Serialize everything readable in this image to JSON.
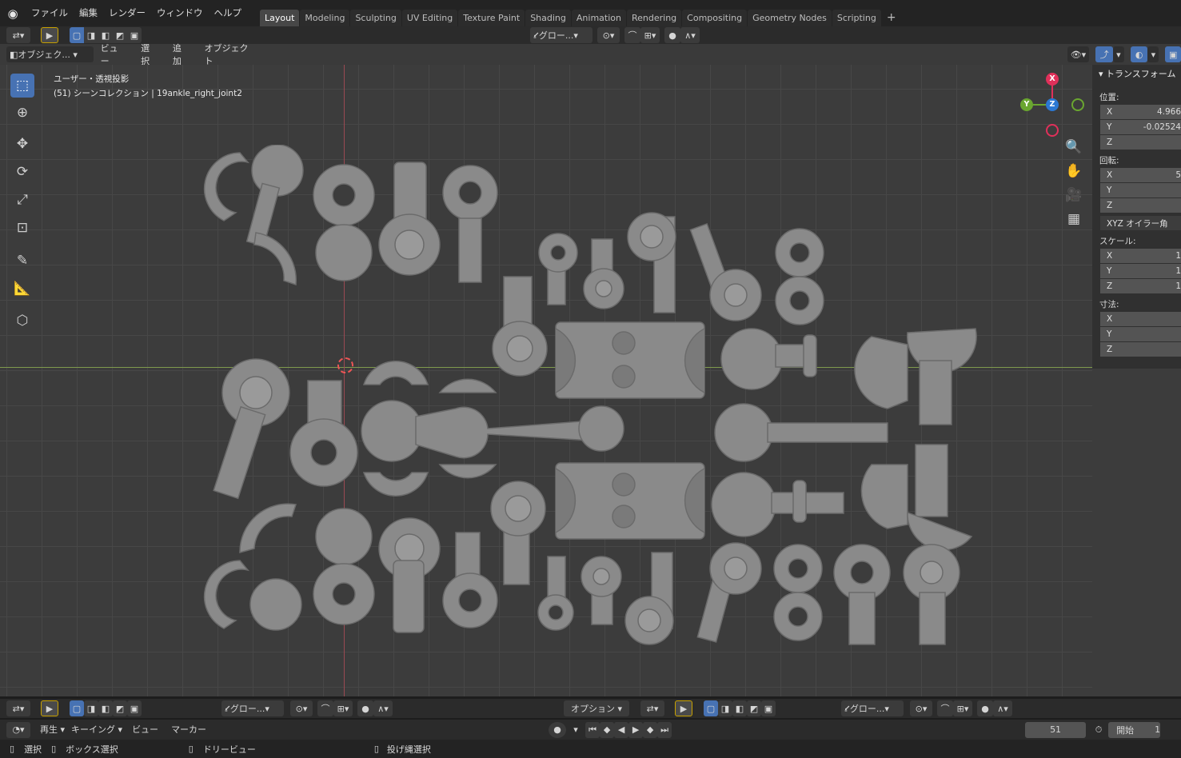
{
  "topbar": {
    "menus": [
      "ファイル",
      "編集",
      "レンダー",
      "ウィンドウ",
      "ヘルプ"
    ],
    "workspaces": [
      "Layout",
      "Modeling",
      "Sculpting",
      "UV Editing",
      "Texture Paint",
      "Shading",
      "Animation",
      "Rendering",
      "Compositing",
      "Geometry Nodes",
      "Scripting"
    ],
    "active_workspace": "Layout",
    "add_tab": "+"
  },
  "toolheader": {
    "transform_orientation": "グロー...",
    "colors": {
      "accent": "#4772b3"
    }
  },
  "viewport_header": {
    "mode": "オブジェク...",
    "menus": [
      "ビュー",
      "選択",
      "追加",
      "オブジェクト"
    ]
  },
  "viewport": {
    "view_name": "ユーザー・透視投影",
    "collection_info": "(51) シーンコレクション | 19ankle_right_joint2",
    "gizmo": {
      "x": "X",
      "y": "Y",
      "z": "Z"
    }
  },
  "npanel": {
    "title": "トランスフォーム",
    "location_label": "位置:",
    "location": [
      {
        "axis": "X",
        "value": "4.966"
      },
      {
        "axis": "Y",
        "value": "-0.02524"
      },
      {
        "axis": "Z",
        "value": ""
      }
    ],
    "rotation_label": "回転:",
    "rotation": [
      {
        "axis": "X",
        "value": "5"
      },
      {
        "axis": "Y",
        "value": ""
      },
      {
        "axis": "Z",
        "value": ""
      }
    ],
    "rotation_mode": "XYZ オイラー角",
    "scale_label": "スケール:",
    "scale": [
      {
        "axis": "X",
        "value": "1"
      },
      {
        "axis": "Y",
        "value": "1"
      },
      {
        "axis": "Z",
        "value": "1"
      }
    ],
    "dimensions_label": "寸法:",
    "dimensions": [
      {
        "axis": "X",
        "value": ""
      },
      {
        "axis": "Y",
        "value": ""
      },
      {
        "axis": "Z",
        "value": ""
      }
    ]
  },
  "bottom_toolbar": {
    "orientation_left": "グロー...",
    "options": "オプション",
    "orientation_right": "グロー..."
  },
  "timeline": {
    "playback": "再生",
    "keying": "キーイング",
    "view": "ビュー",
    "marker": "マーカー",
    "current_frame": "51",
    "start_label": "開始",
    "start_value": "1"
  },
  "statusbar": {
    "select": "選択",
    "box_select": "ボックス選択",
    "dolly": "ドリービュー",
    "lasso": "投げ縄選択"
  }
}
